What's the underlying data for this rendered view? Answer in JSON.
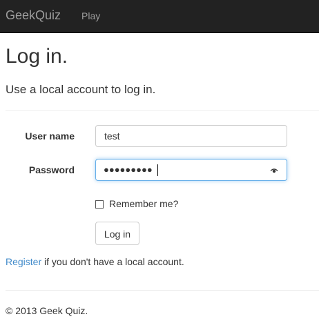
{
  "navbar": {
    "brand": "GeekQuiz",
    "links": [
      {
        "label": "Play"
      }
    ]
  },
  "page": {
    "title": "Log in.",
    "subtitle": "Use a local account to log in."
  },
  "form": {
    "username": {
      "label": "User name",
      "value": "test"
    },
    "password": {
      "label": "Password",
      "masked_value": "●●●●●●●●●",
      "icon": "eye-icon"
    },
    "remember": {
      "label": "Remember me?",
      "checked": false
    },
    "submit_label": "Log in"
  },
  "register": {
    "link_text": "Register",
    "rest_text": " if you don't have a local account."
  },
  "footer": {
    "text": "© 2013 Geek Quiz."
  },
  "colors": {
    "navbar_bg": "#222222",
    "link": "#428bca",
    "focus_border": "#66afe9"
  }
}
